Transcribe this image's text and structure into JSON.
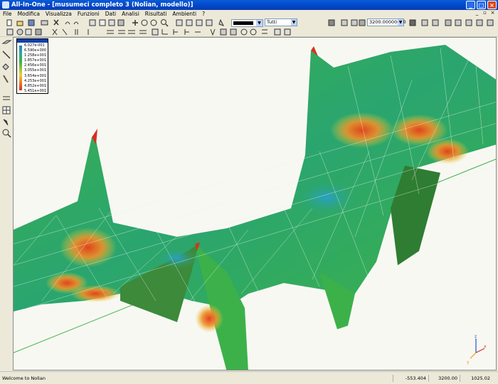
{
  "window": {
    "title": "All-In-One - [musumeci completo 3 (Nolian, modello)]"
  },
  "menu": [
    "File",
    "Modifica",
    "Visualizza",
    "Funzioni",
    "Dati",
    "Analisi",
    "Risultati",
    "Ambienti",
    "?"
  ],
  "toolbar": {
    "layer_value": "Tutti",
    "scale_value": "3200.00000000"
  },
  "legend": {
    "values": [
      "6.027e-001",
      "6.590e+000",
      "1.258e+001",
      "1.857e+001",
      "2.456e+001",
      "3.055e+001",
      "3.654e+001",
      "4.253e+001",
      "4.852e+001",
      "5.451e+001"
    ]
  },
  "status": {
    "message": "Welcome to Nolian",
    "x": "-553.404",
    "y": "3200.00",
    "z": "1025.02"
  },
  "colors": {
    "accent": "#0a5cd8",
    "viewport_bg": "#f8f8f3"
  },
  "axis": {
    "x": "x",
    "y": "y",
    "z": "z"
  }
}
